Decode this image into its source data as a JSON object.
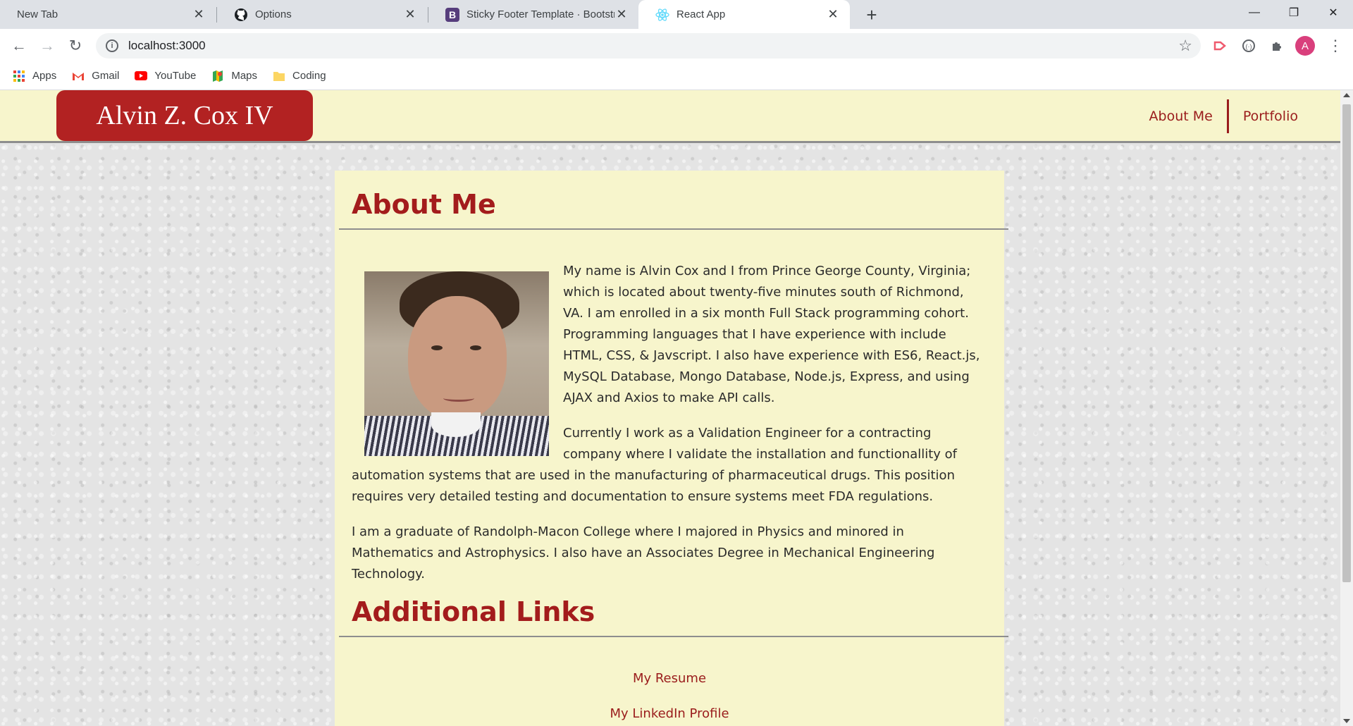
{
  "browser": {
    "tabs": [
      {
        "label": "New Tab",
        "icon": "none",
        "active": false
      },
      {
        "label": "Options",
        "icon": "github-icon",
        "active": false
      },
      {
        "label": "Sticky Footer Template · Bootstra",
        "icon": "bootstrap-icon",
        "active": false
      },
      {
        "label": "React App",
        "icon": "react-icon",
        "active": true
      }
    ],
    "url": "localhost:3000",
    "profile_initial": "A",
    "bookmarks": [
      {
        "label": "Apps",
        "icon": "apps-grid-icon"
      },
      {
        "label": "Gmail",
        "icon": "gmail-icon"
      },
      {
        "label": "YouTube",
        "icon": "youtube-icon"
      },
      {
        "label": "Maps",
        "icon": "maps-icon"
      },
      {
        "label": "Coding",
        "icon": "folder-icon"
      }
    ]
  },
  "site": {
    "brand": "Alvin Z. Cox IV",
    "nav": [
      "About Me",
      "Portfolio"
    ],
    "colors": {
      "accent": "#b22222",
      "background": "#f7f5cc"
    }
  },
  "about": {
    "title": "About Me",
    "paragraphs": [
      "My name is Alvin Cox and I from Prince George County, Virginia; which is located about twenty-five minutes south of Richmond, VA. I am enrolled in a six month Full Stack programming cohort. Programming languages that I have experience with include HTML, CSS, & Javscript. I also have experience with ES6, React.js, MySQL Database, Mongo Database, Node.js, Express, and using AJAX and Axios to make API calls.",
      "Currently I work as a Validation Engineer for a contracting company where I validate the installation and functionallity of automation systems that are used in the manufacturing of pharmaceutical drugs. This position requires very detailed testing and documentation to ensure systems meet FDA regulations.",
      "I am a graduate of Randolph-Macon College where I majored in Physics and minored in Mathematics and Astrophysics. I also have an Associates Degree in Mechanical Engineering Technology."
    ]
  },
  "links": {
    "title": "Additional Links",
    "items": [
      "My Resume",
      "My LinkedIn Profile"
    ]
  }
}
